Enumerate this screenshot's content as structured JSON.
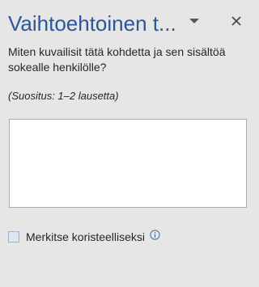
{
  "pane": {
    "title": "Vaihtoehtoinen t...",
    "menu_icon": "chevron-down-icon",
    "close_icon": "close-icon"
  },
  "prompt": {
    "question": "Miten kuvailisit tätä kohdetta ja sen sisältöä sokealle henkilölle?",
    "hint": "(Suositus: 1–2 lausetta)"
  },
  "description": {
    "value": ""
  },
  "decorative": {
    "label": "Merkitse koristeelliseksi",
    "checked": false,
    "info_icon": "info-icon"
  },
  "colors": {
    "title": "#2b579a",
    "background": "#e6e6e6",
    "text": "#262626"
  }
}
